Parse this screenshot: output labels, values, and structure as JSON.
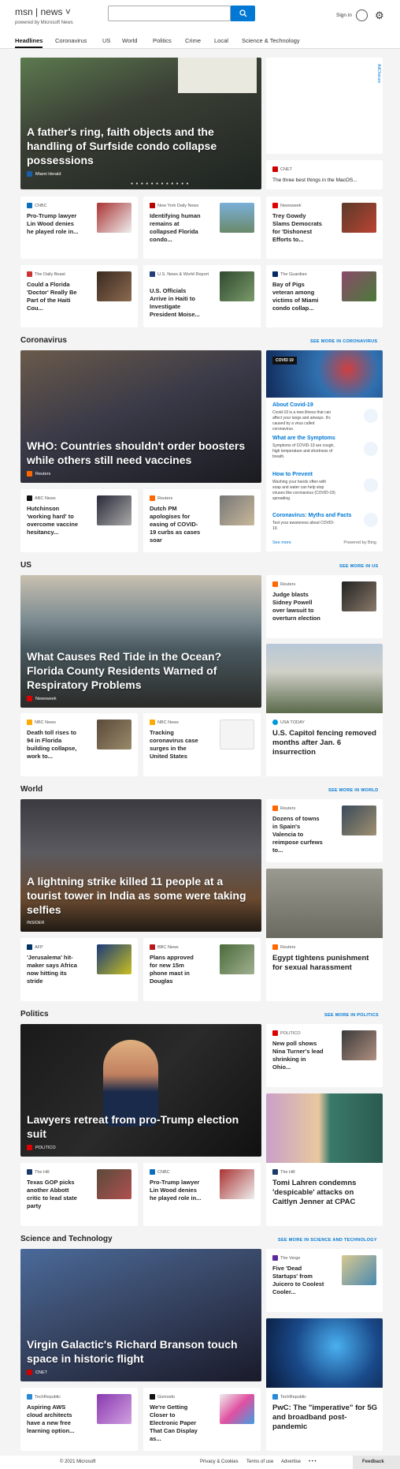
{
  "header": {
    "brand": "msn",
    "section": "news",
    "powered_by": "powered by Microsoft News",
    "search_placeholder": "",
    "sign_in": "Sign in"
  },
  "nav": [
    "Headlines",
    "Coronavirus",
    "US",
    "World",
    "Politics",
    "Crime",
    "Local",
    "Science & Technology"
  ],
  "top": {
    "hero": {
      "title": "A father's ring, faith objects and the handling of Surfside condo collapse possessions",
      "source": "Miami Herald"
    },
    "ad_label": "AdChoices",
    "side_card": {
      "source": "CNET",
      "title": "The three best things in the MacOS..."
    },
    "row1": [
      {
        "source": "CNBC",
        "title": "Pro-Trump lawyer Lin Wood denies he played role in..."
      },
      {
        "source": "New York Daily News",
        "title": "Identifying human remains at collapsed Florida condo..."
      },
      {
        "source": "Newsweek",
        "title": "Trey Gowdy Slams Democrats for 'Dishonest Efforts to..."
      }
    ],
    "row2": [
      {
        "source": "The Daily Beast",
        "title": "Could a Florida 'Doctor' Really Be Part of the Haiti Cou..."
      },
      {
        "source": "U.S. News & World Report",
        "title": "U.S. Officials Arrive in Haiti to Investigate President Moise..."
      },
      {
        "source": "The Guardian",
        "title": "Bay of Pigs veteran among victims of Miami condo collap..."
      }
    ]
  },
  "coronavirus": {
    "section_title": "Coronavirus",
    "see_more": "SEE MORE IN CORONAVIRUS",
    "hero": {
      "title": "WHO: Countries shouldn't order boosters while others still need vaccines",
      "source": "Reuters"
    },
    "cards": [
      {
        "source": "ABC News",
        "title": "Hutchinson 'working hard' to overcome vaccine hesitancy..."
      },
      {
        "source": "Reuters",
        "title": "Dutch PM apologises for easing of COVID-19 curbs as cases soar"
      }
    ],
    "info": {
      "badge": "COVID 19",
      "items": [
        {
          "h": "About Covid-19",
          "d": "Covid-19 is a new illness that can affect your lungs and airways. It's caused by a virus called coronavirus."
        },
        {
          "h": "What are the Symptoms",
          "d": "Symptoms of COVID-19 are cough, high temperature and shortness of breath."
        },
        {
          "h": "How to Prevent",
          "d": "Washing your hands often with soap and water can help stop viruses like coronavirus (COVID-19) spreading."
        },
        {
          "h": "Coronavirus: Myths and Facts",
          "d": "Test your awareness about COVID-19."
        }
      ],
      "see_more": "See more",
      "powered": "Powered by Bing"
    }
  },
  "us": {
    "section_title": "US",
    "see_more": "SEE MORE IN US",
    "hero": {
      "title": "What Causes Red Tide in the Ocean? Florida County Residents Warned of Respiratory Problems",
      "source": "Newsweek"
    },
    "side": {
      "source": "Reuters",
      "title": "Judge blasts Sidney Powell over lawsuit to overturn election"
    },
    "tall": {
      "source": "USA TODAY",
      "title": "U.S. Capitol fencing removed months after Jan. 6 insurrection"
    },
    "cards": [
      {
        "source": "NBC News",
        "title": "Death toll rises to 94 in Florida building collapse, work to..."
      },
      {
        "source": "NBC News",
        "title": "Tracking coronavirus case surges in the United States"
      }
    ]
  },
  "world": {
    "section_title": "World",
    "see_more": "SEE MORE IN WORLD",
    "hero": {
      "title": "A lightning strike killed 11 people at a tourist tower in India as some were taking selfies",
      "source": "INSIDER"
    },
    "side": {
      "source": "Reuters",
      "title": "Dozens of towns in Spain's Valencia to reimpose curfews to..."
    },
    "tall": {
      "source": "Reuters",
      "title": "Egypt tightens punishment for sexual harassment"
    },
    "cards": [
      {
        "source": "AFP",
        "title": "'Jerusalema' hit-maker says Africa now hitting its stride"
      },
      {
        "source": "BBC News",
        "title": "Plans approved for new 15m phone mast in Douglas"
      }
    ]
  },
  "politics": {
    "section_title": "Politics",
    "see_more": "SEE MORE IN POLITICS",
    "hero": {
      "title": "Lawyers retreat from pro-Trump election suit",
      "source": "POLITICO"
    },
    "side": {
      "source": "POLITICO",
      "title": "New poll shows Nina Turner's lead shrinking in Ohio..."
    },
    "tall": {
      "source": "The Hill",
      "title": "Tomi Lahren condemns 'despicable' attacks on Caitlyn Jenner at CPAC"
    },
    "cards": [
      {
        "source": "The Hill",
        "title": "Texas GOP picks another Abbott critic to lead state party"
      },
      {
        "source": "CNBC",
        "title": "Pro-Trump lawyer Lin Wood denies he played role in..."
      }
    ]
  },
  "scitech": {
    "section_title": "Science and Technology",
    "see_more": "SEE MORE IN SCIENCE AND TECHNOLOGY",
    "hero": {
      "title": "Virgin Galactic's Richard Branson touch space in historic flight",
      "source": "CNET"
    },
    "side": {
      "source": "The Verge",
      "title": "Five 'Dead Startups' from Juicero to Coolest Cooler..."
    },
    "tall": {
      "source": "TechRepublic",
      "title": "PwC: The \"imperative\" for 5G and broadband post-pandemic"
    },
    "cards": [
      {
        "source": "TechRepublic",
        "title": "Aspiring AWS cloud architects have a new free learning option..."
      },
      {
        "source": "Gizmodo",
        "title": "We're Getting Closer to Electronic Paper That Can Display as..."
      }
    ]
  },
  "footer": {
    "copyright": "© 2021 Microsoft",
    "privacy": "Privacy & Cookies",
    "terms": "Terms of use",
    "advertise": "Advertise",
    "more": "• • •",
    "feedback": "Feedback"
  },
  "colors": {
    "accent": "#0078d4"
  }
}
